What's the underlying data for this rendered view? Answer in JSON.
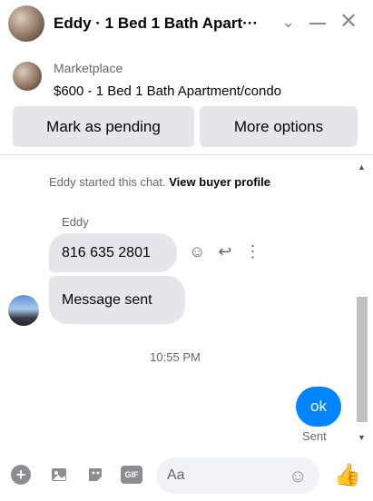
{
  "header": {
    "title": "Eddy · 1 Bed 1 Bath Apart···",
    "icons": {
      "chevron": "chevron-down-icon",
      "minimize": "minimize-icon",
      "close": "close-icon"
    }
  },
  "listing": {
    "label": "Marketplace",
    "item": "$600 - 1 Bed 1 Bath Apartment/condo",
    "buttons": {
      "pending": "Mark as pending",
      "more": "More options"
    }
  },
  "chat": {
    "notice_prefix": "Eddy started this chat.",
    "notice_link": "View buyer profile",
    "sender_name": "Eddy",
    "messages": [
      {
        "text": "816 635 2801",
        "from": "buyer"
      },
      {
        "text": "Message sent",
        "from": "buyer"
      }
    ],
    "timestamp": "10:55 PM",
    "my_message": "ok",
    "status": "Sent"
  },
  "composer": {
    "placeholder": "Aa",
    "icons": [
      "plus-icon",
      "photo-icon",
      "sticker-icon",
      "gif-icon",
      "emoji-icon",
      "like-icon"
    ],
    "gif_label": "GIF"
  },
  "colors": {
    "accent": "#0084ff",
    "bubble": "#e4e6eb",
    "button": "#e4e6eb",
    "muted": "#65676b"
  }
}
